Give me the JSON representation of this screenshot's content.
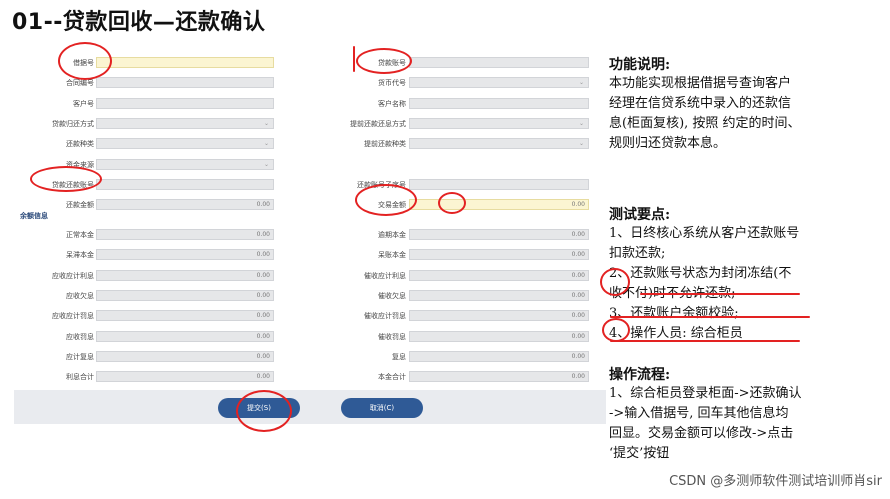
{
  "title": "01--贷款回收—还款确认",
  "form": {
    "left_fields": [
      {
        "label": "借据号",
        "value": "",
        "style": "yellow"
      },
      {
        "label": "合同编号",
        "value": ""
      },
      {
        "label": "客户号",
        "value": ""
      },
      {
        "label": "贷款归还方式",
        "value": "",
        "dropdown": true
      },
      {
        "label": "还款种类",
        "value": "",
        "dropdown": true
      },
      {
        "label": "资金来源",
        "value": "",
        "dropdown": true
      },
      {
        "label": "贷款还款账号",
        "value": ""
      },
      {
        "label": "还款金额",
        "value": "0.00"
      }
    ],
    "right_fields": [
      {
        "label": "贷款账号",
        "value": ""
      },
      {
        "label": "货币代号",
        "value": "",
        "dropdown": true
      },
      {
        "label": "客户名称",
        "value": ""
      },
      {
        "label": "提前还款还息方式",
        "value": "",
        "dropdown": true
      },
      {
        "label": "提前还款种类",
        "value": "",
        "dropdown": true
      },
      {
        "label": "",
        "value": ""
      },
      {
        "label": "还款账号子序号",
        "value": ""
      },
      {
        "label": "交易金额",
        "value": "0.00",
        "style": "yellow"
      }
    ],
    "balance_section": "余额信息",
    "balance_left": [
      {
        "label": "正常本金",
        "value": "0.00"
      },
      {
        "label": "呆滞本金",
        "value": "0.00"
      },
      {
        "label": "应收应计利息",
        "value": "0.00"
      },
      {
        "label": "应收欠息",
        "value": "0.00"
      },
      {
        "label": "应收应计罚息",
        "value": "0.00"
      },
      {
        "label": "应收罚息",
        "value": "0.00"
      },
      {
        "label": "应计复息",
        "value": "0.00"
      },
      {
        "label": "利息合计",
        "value": "0.00"
      }
    ],
    "balance_right": [
      {
        "label": "逾期本金",
        "value": "0.00"
      },
      {
        "label": "呆账本金",
        "value": "0.00"
      },
      {
        "label": "催收应计利息",
        "value": "0.00"
      },
      {
        "label": "催收欠息",
        "value": "0.00"
      },
      {
        "label": "催收应计罚息",
        "value": "0.00"
      },
      {
        "label": "催收罚息",
        "value": "0.00"
      },
      {
        "label": "复息",
        "value": "0.00"
      },
      {
        "label": "本金合计",
        "value": "0.00"
      }
    ],
    "submit_label": "提交(S)",
    "cancel_label": "取消(C)"
  },
  "side": {
    "func_title": "功能说明:",
    "func_lines": [
      "本功能实现根据借据号查询客户",
      "经理在信贷系统中录入的还款信",
      "息(柜面复核), 按照 约定的时间、",
      "规则归还贷款本息。"
    ],
    "test_title": "测试要点:",
    "test_lines": [
      "1、日终核心系统从客户还款账号",
      "扣款还款;",
      "2、还款账号状态为封闭冻结(不",
      "收不付)时不允许还款;",
      "3、还款账户余额校验;",
      "4、操作人员: 综合柜员"
    ],
    "flow_title": "操作流程:",
    "flow_lines": [
      "1、综合柜员登录柜面->还款确认",
      "->输入借据号, 回车其他信息均",
      "回显。交易金额可以修改->点击",
      "‘提交’按钮"
    ]
  },
  "watermark": "CSDN @多测师软件测试培训师肖sir",
  "colors": {
    "accent": "#2f5a96",
    "highlight": "#e32222",
    "input_bg": "#e6e7e9",
    "input_yellow": "#fbf5d2"
  }
}
